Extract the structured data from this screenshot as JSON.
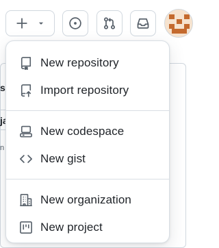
{
  "header": {
    "create_icon": "plus-icon",
    "create_caret_icon": "triangle-down-icon",
    "issues_icon": "issue-opened-icon",
    "pulls_icon": "git-pull-request-icon",
    "inbox_icon": "inbox-icon",
    "avatar_icon": "identicon-avatar"
  },
  "background_fragments": [
    "s",
    "ja",
    "n"
  ],
  "menu": {
    "groups": [
      [
        {
          "label": "New repository",
          "icon": "repo-icon"
        },
        {
          "label": "Import repository",
          "icon": "repo-push-icon"
        }
      ],
      [
        {
          "label": "New codespace",
          "icon": "codespaces-icon"
        },
        {
          "label": "New gist",
          "icon": "code-icon"
        }
      ],
      [
        {
          "label": "New organization",
          "icon": "organization-icon"
        },
        {
          "label": "New project",
          "icon": "project-icon"
        }
      ]
    ]
  },
  "colors": {
    "border": "#d0d7de",
    "text": "#1f2328",
    "muted": "#57606a",
    "avatar_accent": "#c46a2e"
  }
}
